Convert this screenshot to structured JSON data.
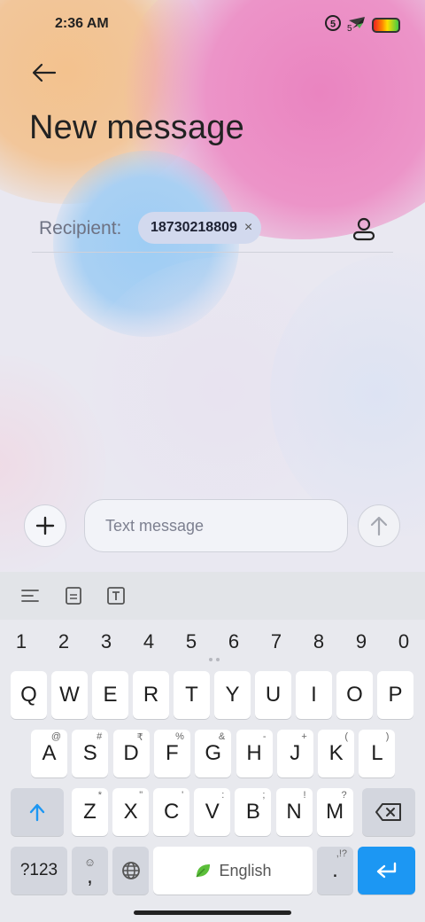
{
  "status_bar": {
    "time": "2:36 AM",
    "sim_badge": "5",
    "signal_sub": "5"
  },
  "header": {
    "back_icon": "arrow-left-icon",
    "title": "New message"
  },
  "recipient": {
    "label": "Recipient:",
    "chip_text": "18730218809",
    "chip_close": "×",
    "contact_icon": "contact-icon"
  },
  "compose": {
    "add_icon": "plus-icon",
    "placeholder": "Text message",
    "send_icon": "arrow-up-icon"
  },
  "keyboard_toolbar": {
    "icons": [
      "text-align-icon",
      "clipboard-icon",
      "text-format-icon"
    ]
  },
  "keyboard": {
    "numbers": [
      "1",
      "2",
      "3",
      "4",
      "5",
      "6",
      "7",
      "8",
      "9",
      "0"
    ],
    "row1": [
      "Q",
      "W",
      "E",
      "R",
      "T",
      "Y",
      "U",
      "I",
      "O",
      "P"
    ],
    "row2": [
      "A",
      "S",
      "D",
      "F",
      "G",
      "H",
      "J",
      "K",
      "L"
    ],
    "row2_hints": [
      "@",
      "#",
      "₹",
      "%",
      "&",
      "-",
      "+",
      "(",
      ")"
    ],
    "row3": [
      "Z",
      "X",
      "C",
      "V",
      "B",
      "N",
      "M"
    ],
    "row3_hints": [
      "*",
      "\"",
      "'",
      ":",
      ";",
      "!",
      "?"
    ],
    "sym_key": "?123",
    "comma_key": ",",
    "space_label": "English",
    "period_key": ".",
    "period_hint": ",!?",
    "colors": {
      "enter": "#1c97f3",
      "leaf": "#5bbf3a"
    }
  }
}
